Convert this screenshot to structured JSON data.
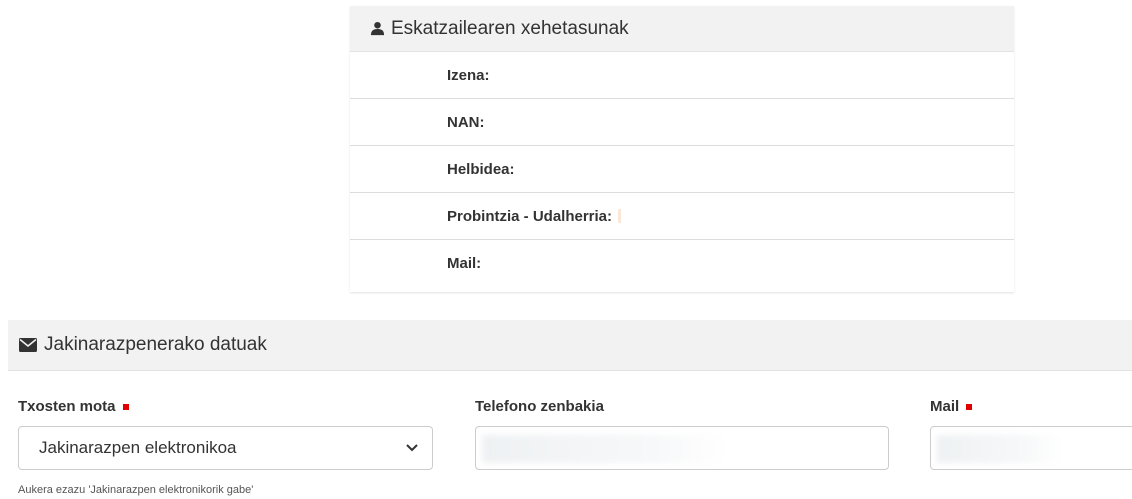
{
  "applicant": {
    "heading": "Eskatzailearen xehetasunak",
    "icon": "user-icon",
    "rows": [
      {
        "label": "Izena:",
        "value": ""
      },
      {
        "label": "NAN:",
        "value": ""
      },
      {
        "label": "Helbidea:",
        "value": ""
      },
      {
        "label": "Probintzia - Udalherria:",
        "value": ""
      },
      {
        "label": "Mail:",
        "value": ""
      }
    ]
  },
  "notification": {
    "heading": "Jakinarazpenerako datuak",
    "icon": "envelope-icon",
    "report_type": {
      "label": "Txosten mota",
      "required": true,
      "selected": "Jakinarazpen elektronikoa",
      "help": "Aukera ezazu 'Jakinarazpen elektronikorik gabe'"
    },
    "phone": {
      "label": "Telefono zenbakia",
      "value": ""
    },
    "mail": {
      "label": "Mail",
      "required": true,
      "value": ""
    }
  },
  "colors": {
    "required_marker": "#e00000",
    "heading_bg": "#f2f2f2"
  }
}
